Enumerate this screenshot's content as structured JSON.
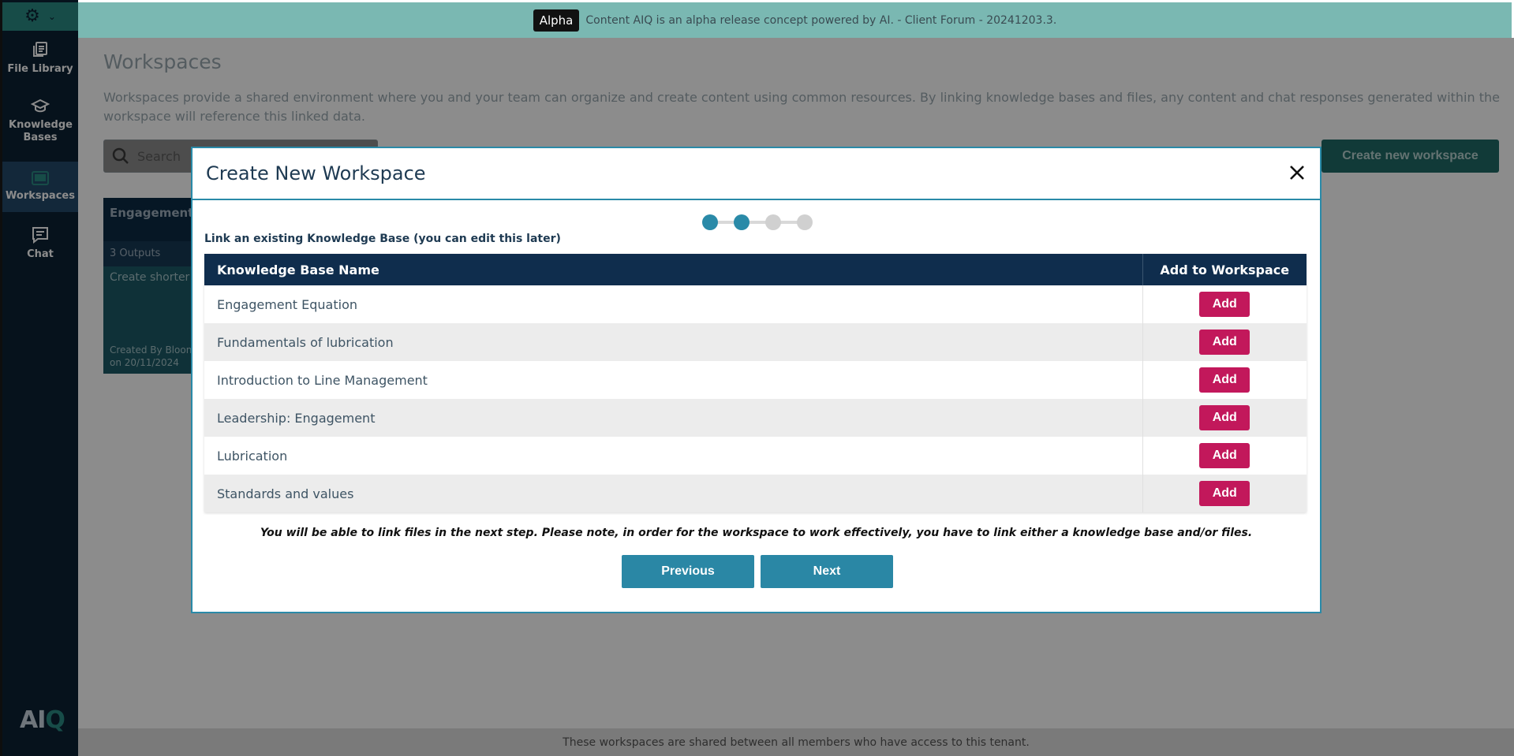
{
  "banner": {
    "badge": "Alpha",
    "text": "Content AIQ is an alpha release concept powered by AI. - Client Forum - 20241203.3."
  },
  "sidebar": {
    "items": [
      {
        "label": "File Library",
        "icon": "file-library-icon"
      },
      {
        "label": "Knowledge Bases",
        "icon": "graduation-cap-icon"
      },
      {
        "label": "Workspaces",
        "icon": "workspaces-icon",
        "active": true
      },
      {
        "label": "Chat",
        "icon": "chat-icon"
      }
    ],
    "logo": "AIQ"
  },
  "main": {
    "title": "Workspaces",
    "description": "Workspaces provide a shared environment where you and your team can organize and create content using common resources. By linking knowledge bases and files, any content and chat responses generated within the workspace will reference this linked data.",
    "search_placeholder": "Search",
    "create_button": "Create new workspace",
    "card": {
      "title": "Engagement",
      "outputs": "3 Outputs",
      "item": "Create shorter",
      "created_by": "Created By Bloon",
      "created_on": "on 20/11/2024"
    },
    "footer": "These workspaces are shared between all members who have access to this tenant."
  },
  "modal": {
    "title": "Create New Workspace",
    "steps_total": 4,
    "steps_completed": 2,
    "link_label": "Link an existing Knowledge Base (you can edit this later)",
    "table_headers": {
      "name": "Knowledge Base Name",
      "add": "Add to Workspace"
    },
    "knowledge_bases": [
      "Engagement Equation",
      "Fundamentals of lubrication",
      "Introduction to Line Management",
      "Leadership: Engagement",
      "Lubrication",
      "Standards and values"
    ],
    "add_label": "Add",
    "note": "You will be able to link files in the next step. Please note, in order for the workspace to work effectively, you have to link either a knowledge base and/or files.",
    "previous_label": "Previous",
    "next_label": "Next"
  },
  "colors": {
    "primary": "#2a87a5",
    "add_button": "#c2185b",
    "table_header": "#0f2d4d",
    "sidebar": "#0c2133",
    "banner": "#7ab8b2"
  }
}
